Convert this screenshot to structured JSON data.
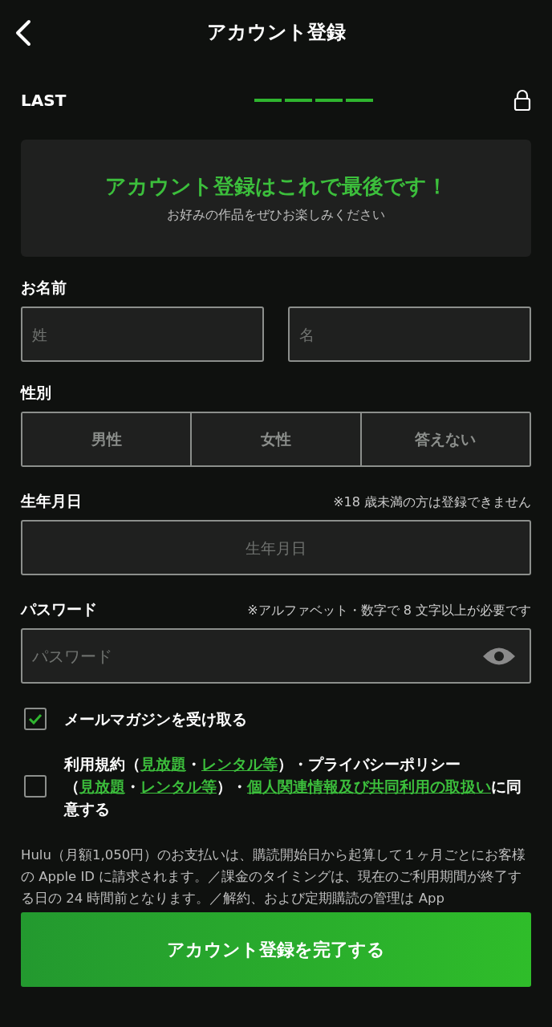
{
  "header": {
    "title": "アカウント登録"
  },
  "progress": {
    "label": "LAST",
    "steps": [
      {
        "done": true
      },
      {
        "done": true
      },
      {
        "done": true
      },
      {
        "done": true
      }
    ]
  },
  "banner": {
    "title": "アカウント登録はこれで最後です！",
    "subtitle": "お好みの作品をぜひお楽しみください"
  },
  "name": {
    "label": "お名前",
    "fields": [
      {
        "placeholder": "姓"
      },
      {
        "placeholder": "名"
      }
    ]
  },
  "gender": {
    "label": "性別",
    "options": [
      {
        "label": "男性",
        "selected": false
      },
      {
        "label": "女性",
        "selected": false
      },
      {
        "label": "答えない",
        "selected": false
      }
    ]
  },
  "birthday": {
    "label": "生年月日",
    "note": "※18 歳未満の方は登録できません",
    "placeholder": "生年月日"
  },
  "password": {
    "label": "パスワード",
    "note": "※アルファベット・数字で 8 文字以上が必要です",
    "placeholder": "パスワード"
  },
  "newsletter": {
    "label": "メールマガジンを受け取る",
    "checked": true
  },
  "agreement": {
    "checked": false,
    "segments": [
      {
        "text": "利用規約（",
        "link": false
      },
      {
        "text": "見放題",
        "link": true
      },
      {
        "text": "・",
        "link": false
      },
      {
        "text": "レンタル等",
        "link": true
      },
      {
        "text": "）・プライバシーポリシー（",
        "link": false
      },
      {
        "text": "見放題",
        "link": true
      },
      {
        "text": "・",
        "link": false
      },
      {
        "text": "レンタル等",
        "link": true
      },
      {
        "text": "）・",
        "link": false
      },
      {
        "text": "個人関連情報及び共同利用の取扱い",
        "link": true
      },
      {
        "text": "に同意する",
        "link": false
      }
    ]
  },
  "notice": "Hulu（月額1,050円）のお支払いは、購読開始日から起算して１ヶ月ごとにお客様の Apple ID に請求されます。／課金のタイミングは、現在のご利用期間が終了する日の 24 時間前となります。／解約、および定期購読の管理は App",
  "submit": "アカウント登録を完了する"
}
